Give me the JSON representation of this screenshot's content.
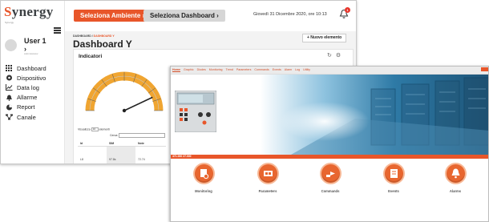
{
  "app": {
    "logo_main": "S",
    "logo_rest": "ynergy",
    "logo_sub": "Synergy"
  },
  "user": {
    "name": "User 1",
    "role": "Administrator"
  },
  "sidebar": {
    "items": [
      {
        "label": "Dashboard",
        "icon": "dashboard-icon"
      },
      {
        "label": "Dispositivo",
        "icon": "device-icon"
      },
      {
        "label": "Data log",
        "icon": "chart-icon"
      },
      {
        "label": "Allarme",
        "icon": "bell-icon"
      },
      {
        "label": "Report",
        "icon": "report-icon"
      },
      {
        "label": "Canale",
        "icon": "channel-icon"
      }
    ]
  },
  "topbar": {
    "env_button": "Seleziona Ambiente",
    "dash_button": "Seleziona Dashboard",
    "datetime": "Giovedì 31 Dicembre 2020, ore 10:13",
    "notifications": "1"
  },
  "main": {
    "breadcrumb_root": "DASHBOARD",
    "breadcrumb_sep": " / ",
    "breadcrumb_current": "DASHBOARD Y",
    "title": "Dashboard Y",
    "new_button": "+ Nuovo elemento",
    "panel_title": "Indicatori",
    "visualizza_label": "Visualizza",
    "visualizza_value": "10",
    "elementi_label": "elementi",
    "cerca_label": "Cerca:",
    "table_headers": [
      "Id",
      "SIM",
      "Note"
    ],
    "table_rows": [
      [
        "",
        "",
        ""
      ],
      [
        "L8",
        "97.8s",
        "72.74"
      ]
    ]
  },
  "gauge": {
    "value_fraction": 0.86,
    "accent": "#f0a531"
  },
  "front": {
    "nav": [
      "Home",
      "Graphic",
      "Diodes",
      "Monitoring",
      "Trend",
      "Parameters",
      "Commands",
      "Events",
      "Alarm",
      "Log",
      "Utility"
    ],
    "status_strip": "471.000 27.000",
    "tiles": [
      {
        "label": "Monitoring",
        "icon": "monitoring-icon"
      },
      {
        "label": "Parameters",
        "icon": "parameters-icon"
      },
      {
        "label": "Commands",
        "icon": "commands-icon"
      },
      {
        "label": "Events",
        "icon": "events-icon"
      },
      {
        "label": "Alarms",
        "icon": "alarms-icon"
      }
    ]
  },
  "colors": {
    "brand_orange": "#e8562a",
    "tile_orange": "#e8662f",
    "hero_blue": "#2a6d95"
  }
}
